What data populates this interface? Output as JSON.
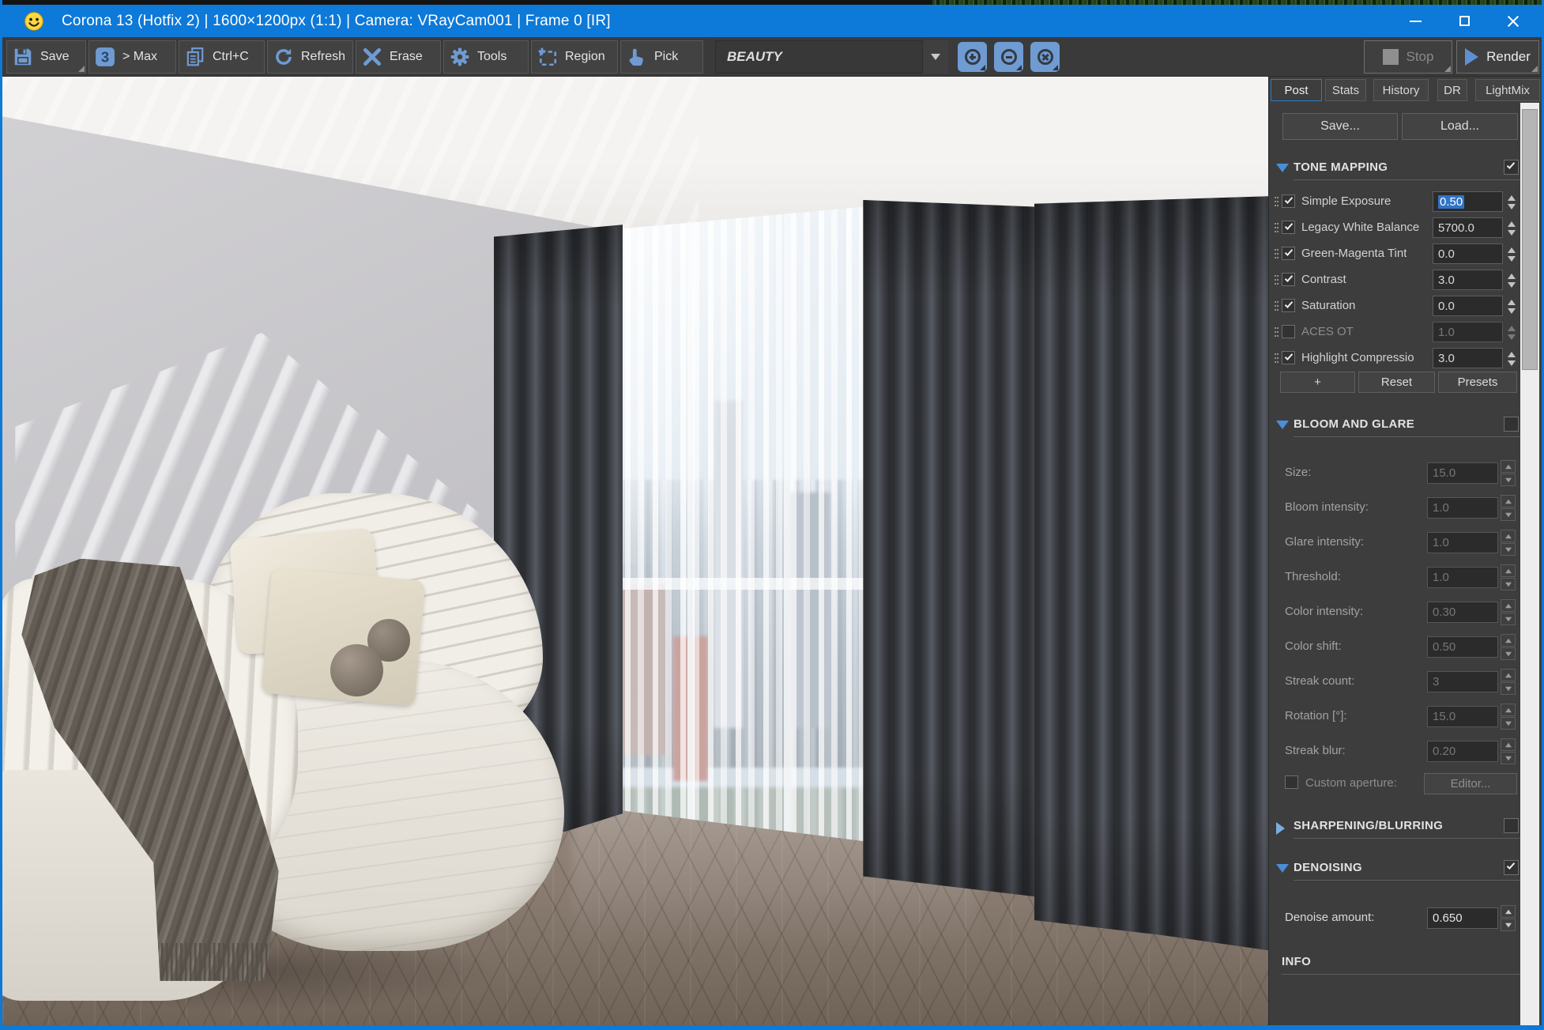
{
  "titlebar": {
    "title": "Corona 13 (Hotfix 2) | 1600×1200px (1:1) | Camera: VRayCam001 | Frame 0 [IR]"
  },
  "toolbar": {
    "save": "Save",
    "max_icon": "3",
    "max": "> Max",
    "copy": "Ctrl+C",
    "refresh": "Refresh",
    "erase": "Erase",
    "tools": "Tools",
    "region": "Region",
    "pick": "Pick",
    "channel": "BEAUTY",
    "stop": "Stop",
    "render": "Render"
  },
  "panel": {
    "tabs": [
      {
        "label": "Post"
      },
      {
        "label": "Stats"
      },
      {
        "label": "History"
      },
      {
        "label": "DR"
      },
      {
        "label": "LightMix"
      }
    ],
    "save": "Save...",
    "load": "Load...",
    "tone_mapping": {
      "title": "TONE MAPPING",
      "rows": [
        {
          "label": "Simple Exposure",
          "value": "0.50"
        },
        {
          "label": "Legacy White Balance",
          "value": "5700.0"
        },
        {
          "label": "Green-Magenta Tint",
          "value": "0.0"
        },
        {
          "label": "Contrast",
          "value": "3.0"
        },
        {
          "label": "Saturation",
          "value": "0.0"
        },
        {
          "label": "ACES OT",
          "value": "1.0"
        },
        {
          "label": "Highlight Compressio",
          "value": "3.0"
        }
      ],
      "buttons": [
        "+",
        "Reset",
        "Presets"
      ]
    },
    "bloom": {
      "title": "BLOOM AND GLARE",
      "rows": [
        {
          "label": "Size:",
          "value": "15.0"
        },
        {
          "label": "Bloom intensity:",
          "value": "1.0"
        },
        {
          "label": "Glare intensity:",
          "value": "1.0"
        },
        {
          "label": "Threshold:",
          "value": "1.0"
        },
        {
          "label": "Color intensity:",
          "value": "0.30"
        },
        {
          "label": "Color shift:",
          "value": "0.50"
        },
        {
          "label": "Streak count:",
          "value": "3"
        },
        {
          "label": "Rotation [°]:",
          "value": "15.0"
        },
        {
          "label": "Streak blur:",
          "value": "0.20"
        }
      ],
      "custom_aperture": "Custom aperture:",
      "editor": "Editor..."
    },
    "sharpening": {
      "title": "SHARPENING/BLURRING"
    },
    "denoising": {
      "title": "DENOISING",
      "row": {
        "label": "Denoise amount:",
        "value": "0.650"
      }
    },
    "info": {
      "title": "INFO"
    }
  },
  "colors": {
    "accent_blue": "#0d79d8",
    "icon_blue": "#6f9bd3",
    "selection_blue": "#2f74c6",
    "tab_active_border": "#2d7cc4"
  }
}
